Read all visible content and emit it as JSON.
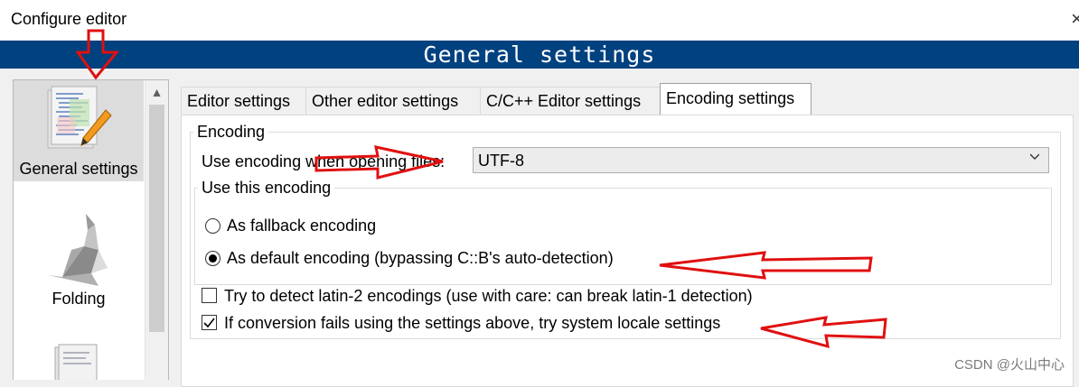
{
  "window": {
    "title": "Configure editor",
    "close_glyph": "×"
  },
  "banner": {
    "title": "General settings"
  },
  "sidebar": {
    "items": [
      {
        "label": "General settings",
        "icon": "document-pencil-icon",
        "selected": true
      },
      {
        "label": "Folding",
        "icon": "origami-bird-icon",
        "selected": false
      },
      {
        "label": "",
        "icon": "document-icon",
        "selected": false
      }
    ],
    "scroll_up_glyph": "▲"
  },
  "tabs": [
    {
      "label": "Editor settings",
      "active": false
    },
    {
      "label": "Other editor settings",
      "active": false
    },
    {
      "label": "C/C++ Editor settings",
      "active": false
    },
    {
      "label": "Encoding settings",
      "active": true
    }
  ],
  "encoding": {
    "group_label": "Encoding",
    "open_label": "Use encoding when opening files:",
    "selected_encoding": "UTF-8",
    "use_group_label": "Use this encoding",
    "radio_fallback": {
      "label": "As fallback encoding",
      "checked": false
    },
    "radio_default": {
      "label": "As default encoding (bypassing C::B's auto-detection)",
      "checked": true
    },
    "check_latin2": {
      "label": "Try to detect latin-2 encodings (use with care: can break latin-1 detection)",
      "checked": false
    },
    "check_locale": {
      "label": "If conversion fails using the settings above, try system locale settings",
      "checked": true
    }
  },
  "watermark": "CSDN @火山中心",
  "colors": {
    "banner": "#00417f",
    "annotation": "#e01010"
  }
}
